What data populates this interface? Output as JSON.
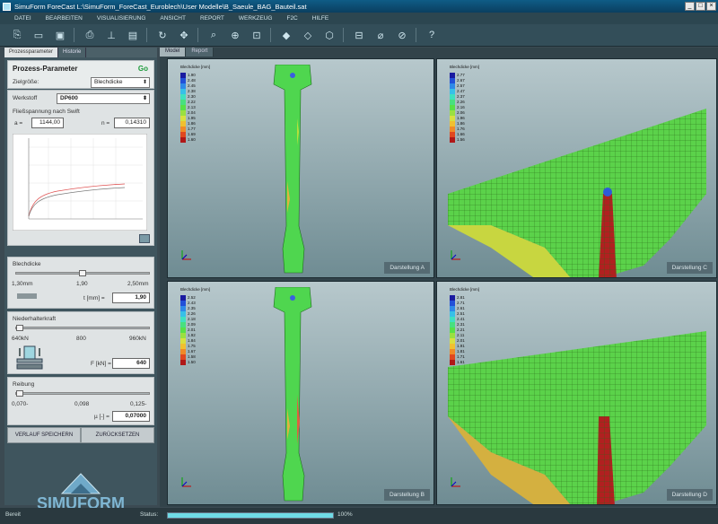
{
  "window": {
    "title": "SimuForm ForeCast   L:\\SimuForm_ForeCast_Euroblech\\User Modelle\\B_Saeule_BAG_Bauteil.sat"
  },
  "menu": [
    "DATEI",
    "BEARBEITEN",
    "VISUALISIERUNG",
    "ANSICHT",
    "REPORT",
    "WERKZEUG",
    "F2C",
    "HILFE"
  ],
  "toolbar": {
    "icons": [
      "open-part-icon",
      "open-folder-icon",
      "save-icon",
      "print-icon",
      "measure-icon",
      "document-icon",
      "rotate-icon",
      "pan-icon",
      "zoom-icon",
      "zoom-window-icon",
      "zoom-fit-icon",
      "view-iso-icon",
      "view-front-icon",
      "view-side-icon",
      "section-icon",
      "probe-icon",
      "probe-max-icon",
      "help-icon"
    ],
    "help_label": "?"
  },
  "left": {
    "tabs": [
      "Prozessparameter",
      "Historie"
    ],
    "title": "Prozess-Parameter",
    "go": "Go",
    "zielgroesse_label": "Zielgröße:",
    "zielgroesse_value": "Blechdicke",
    "werkstoff_label": "Werkstoff",
    "werkstoff_value": "DP600",
    "flow_title": "Fließspannung nach Swift",
    "a_label": "a =",
    "a_value": "1144,00",
    "n_label": "n =",
    "n_value": "0,14310",
    "blechdicke": {
      "title": "Blechdicke",
      "min": "1,30mm",
      "mid": "1,90",
      "max": "2,50mm",
      "field_label": "t [mm] =",
      "value": "1,90",
      "level": 0.5
    },
    "niederhalter": {
      "title": "Niederhalterkraft",
      "min": "640kN",
      "mid": "800",
      "max": "960kN",
      "field_label": "F [kN] =",
      "value": "640",
      "level": 0.0
    },
    "reibung": {
      "title": "Reibung",
      "min": "0,070-",
      "mid": "0,098",
      "max": "0,125-",
      "field_label": "µ [-] =",
      "value": "0,07000",
      "level": 0.0
    },
    "save_button": "VERLAUF SPEICHERN",
    "reset_button": "ZURÜCKSETZEN",
    "logo_text": "SIMUFORM"
  },
  "views": {
    "tabs": [
      "Model",
      "Report"
    ],
    "legend_title": "Blechdicke [mm]",
    "panels": [
      {
        "label": "Darstellung A",
        "legend": [
          "1.90",
          "2.48",
          "2.45",
          "2.38",
          "2.30",
          "2.22",
          "2.13",
          "2.04",
          "1.95",
          "1.86",
          "1.77",
          "1.69",
          "1.60"
        ]
      },
      {
        "label": "Darstellung C",
        "legend": [
          "2.77",
          "2.67",
          "2.57",
          "2.47",
          "2.37",
          "2.26",
          "2.16",
          "2.06",
          "1.96",
          "1.86",
          "1.76",
          "1.66",
          "1.56"
        ]
      },
      {
        "label": "Darstellung B",
        "legend": [
          "2.52",
          "2.43",
          "2.35",
          "2.26",
          "2.18",
          "2.09",
          "2.01",
          "1.92",
          "1.84",
          "1.75",
          "1.67",
          "1.58",
          "1.50"
        ]
      },
      {
        "label": "Darstellung D",
        "legend": [
          "2.81",
          "2.71",
          "2.61",
          "2.51",
          "2.41",
          "2.31",
          "2.21",
          "2.11",
          "2.01",
          "1.91",
          "1.81",
          "1.71",
          "1.61"
        ]
      }
    ]
  },
  "status": {
    "left": "Bereit",
    "label": "Status:",
    "progress": "100%",
    "progress_level": 1.0
  }
}
